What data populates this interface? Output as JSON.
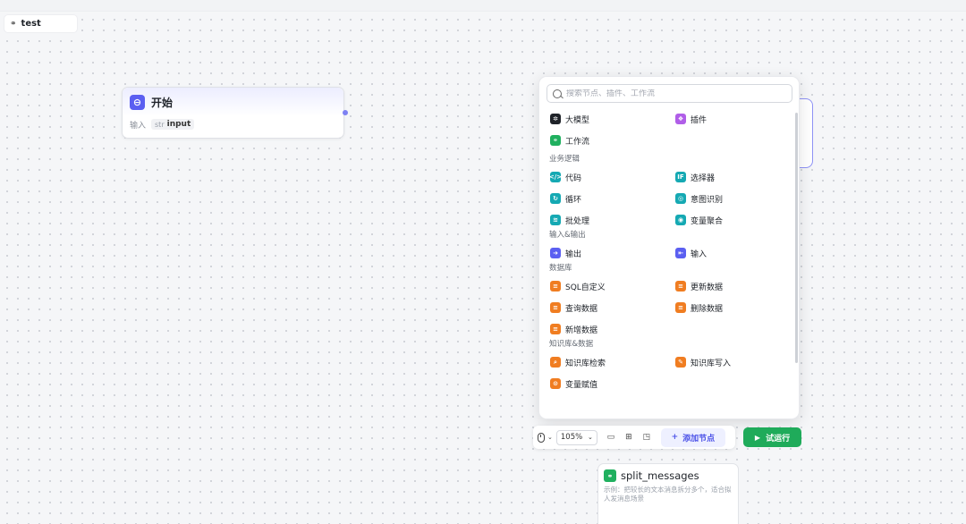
{
  "workflow": {
    "name": "test"
  },
  "start_node": {
    "title": "开始",
    "param_label": "输入",
    "param_type": "str",
    "param_name": "input"
  },
  "panel": {
    "search_placeholder": "搜索节点、插件、工作流",
    "top_items": [
      {
        "label": "大模型",
        "icon": "llm-icon",
        "color": "#1f2329"
      },
      {
        "label": "插件",
        "icon": "plugin-icon",
        "color": "#b05ee8"
      },
      {
        "label": "工作流",
        "icon": "workflow-icon",
        "color": "#20b05f"
      }
    ],
    "sections": [
      {
        "title": "业务逻辑",
        "items": [
          {
            "label": "代码",
            "icon": "code-icon",
            "color": "#15a9b3"
          },
          {
            "label": "选择器",
            "icon": "if-icon",
            "color": "#15a9b3"
          },
          {
            "label": "循环",
            "icon": "loop-icon",
            "color": "#15a9b3"
          },
          {
            "label": "意图识别",
            "icon": "intent-icon",
            "color": "#15a9b3"
          },
          {
            "label": "批处理",
            "icon": "batch-icon",
            "color": "#15a9b3"
          },
          {
            "label": "变量聚合",
            "icon": "aggregate-icon",
            "color": "#15a9b3"
          }
        ]
      },
      {
        "title": "输入&输出",
        "items": [
          {
            "label": "输出",
            "icon": "output-icon",
            "color": "#5b5ff1"
          },
          {
            "label": "输入",
            "icon": "input-icon",
            "color": "#5b5ff1"
          }
        ]
      },
      {
        "title": "数据库",
        "items": [
          {
            "label": "SQL自定义",
            "icon": "sql-icon",
            "color": "#f07d21"
          },
          {
            "label": "更新数据",
            "icon": "update-data-icon",
            "color": "#f07d21"
          },
          {
            "label": "查询数据",
            "icon": "query-data-icon",
            "color": "#f07d21"
          },
          {
            "label": "删除数据",
            "icon": "delete-data-icon",
            "color": "#f07d21"
          },
          {
            "label": "新增数据",
            "icon": "insert-data-icon",
            "color": "#f07d21"
          }
        ]
      },
      {
        "title": "知识库&数据",
        "items": [
          {
            "label": "知识库检索",
            "icon": "kb-search-icon",
            "color": "#f07d21"
          },
          {
            "label": "知识库写入",
            "icon": "kb-write-icon",
            "color": "#f07d21"
          },
          {
            "label": "变量赋值",
            "icon": "assign-icon",
            "color": "#f07d21"
          }
        ]
      }
    ]
  },
  "toolbar": {
    "zoom": "105%",
    "add_node_label": "添加节点",
    "run_label": "试运行"
  },
  "workflow_node": {
    "title": "split_messages",
    "description": "示例：把较长的文本消息拆分多个，适合拟人发消息场景"
  }
}
